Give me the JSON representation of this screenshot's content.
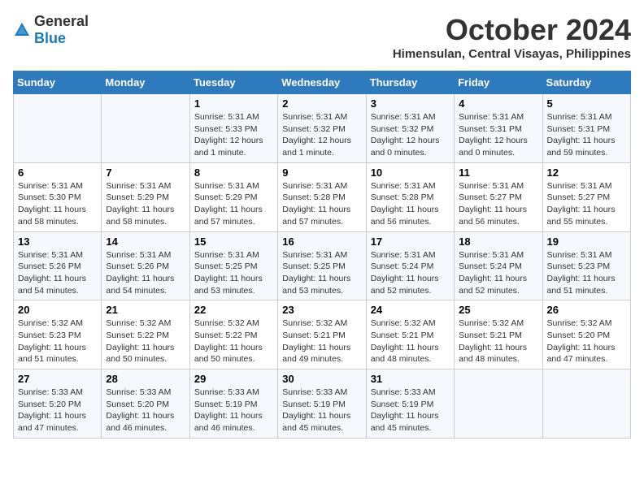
{
  "logo": {
    "text_general": "General",
    "text_blue": "Blue"
  },
  "header": {
    "month": "October 2024",
    "location": "Himensulan, Central Visayas, Philippines"
  },
  "days_of_week": [
    "Sunday",
    "Monday",
    "Tuesday",
    "Wednesday",
    "Thursday",
    "Friday",
    "Saturday"
  ],
  "weeks": [
    [
      {
        "day": "",
        "info": ""
      },
      {
        "day": "",
        "info": ""
      },
      {
        "day": "1",
        "info": "Sunrise: 5:31 AM\nSunset: 5:33 PM\nDaylight: 12 hours and 1 minute."
      },
      {
        "day": "2",
        "info": "Sunrise: 5:31 AM\nSunset: 5:32 PM\nDaylight: 12 hours and 1 minute."
      },
      {
        "day": "3",
        "info": "Sunrise: 5:31 AM\nSunset: 5:32 PM\nDaylight: 12 hours and 0 minutes."
      },
      {
        "day": "4",
        "info": "Sunrise: 5:31 AM\nSunset: 5:31 PM\nDaylight: 12 hours and 0 minutes."
      },
      {
        "day": "5",
        "info": "Sunrise: 5:31 AM\nSunset: 5:31 PM\nDaylight: 11 hours and 59 minutes."
      }
    ],
    [
      {
        "day": "6",
        "info": "Sunrise: 5:31 AM\nSunset: 5:30 PM\nDaylight: 11 hours and 58 minutes."
      },
      {
        "day": "7",
        "info": "Sunrise: 5:31 AM\nSunset: 5:29 PM\nDaylight: 11 hours and 58 minutes."
      },
      {
        "day": "8",
        "info": "Sunrise: 5:31 AM\nSunset: 5:29 PM\nDaylight: 11 hours and 57 minutes."
      },
      {
        "day": "9",
        "info": "Sunrise: 5:31 AM\nSunset: 5:28 PM\nDaylight: 11 hours and 57 minutes."
      },
      {
        "day": "10",
        "info": "Sunrise: 5:31 AM\nSunset: 5:28 PM\nDaylight: 11 hours and 56 minutes."
      },
      {
        "day": "11",
        "info": "Sunrise: 5:31 AM\nSunset: 5:27 PM\nDaylight: 11 hours and 56 minutes."
      },
      {
        "day": "12",
        "info": "Sunrise: 5:31 AM\nSunset: 5:27 PM\nDaylight: 11 hours and 55 minutes."
      }
    ],
    [
      {
        "day": "13",
        "info": "Sunrise: 5:31 AM\nSunset: 5:26 PM\nDaylight: 11 hours and 54 minutes."
      },
      {
        "day": "14",
        "info": "Sunrise: 5:31 AM\nSunset: 5:26 PM\nDaylight: 11 hours and 54 minutes."
      },
      {
        "day": "15",
        "info": "Sunrise: 5:31 AM\nSunset: 5:25 PM\nDaylight: 11 hours and 53 minutes."
      },
      {
        "day": "16",
        "info": "Sunrise: 5:31 AM\nSunset: 5:25 PM\nDaylight: 11 hours and 53 minutes."
      },
      {
        "day": "17",
        "info": "Sunrise: 5:31 AM\nSunset: 5:24 PM\nDaylight: 11 hours and 52 minutes."
      },
      {
        "day": "18",
        "info": "Sunrise: 5:31 AM\nSunset: 5:24 PM\nDaylight: 11 hours and 52 minutes."
      },
      {
        "day": "19",
        "info": "Sunrise: 5:31 AM\nSunset: 5:23 PM\nDaylight: 11 hours and 51 minutes."
      }
    ],
    [
      {
        "day": "20",
        "info": "Sunrise: 5:32 AM\nSunset: 5:23 PM\nDaylight: 11 hours and 51 minutes."
      },
      {
        "day": "21",
        "info": "Sunrise: 5:32 AM\nSunset: 5:22 PM\nDaylight: 11 hours and 50 minutes."
      },
      {
        "day": "22",
        "info": "Sunrise: 5:32 AM\nSunset: 5:22 PM\nDaylight: 11 hours and 50 minutes."
      },
      {
        "day": "23",
        "info": "Sunrise: 5:32 AM\nSunset: 5:21 PM\nDaylight: 11 hours and 49 minutes."
      },
      {
        "day": "24",
        "info": "Sunrise: 5:32 AM\nSunset: 5:21 PM\nDaylight: 11 hours and 48 minutes."
      },
      {
        "day": "25",
        "info": "Sunrise: 5:32 AM\nSunset: 5:21 PM\nDaylight: 11 hours and 48 minutes."
      },
      {
        "day": "26",
        "info": "Sunrise: 5:32 AM\nSunset: 5:20 PM\nDaylight: 11 hours and 47 minutes."
      }
    ],
    [
      {
        "day": "27",
        "info": "Sunrise: 5:33 AM\nSunset: 5:20 PM\nDaylight: 11 hours and 47 minutes."
      },
      {
        "day": "28",
        "info": "Sunrise: 5:33 AM\nSunset: 5:20 PM\nDaylight: 11 hours and 46 minutes."
      },
      {
        "day": "29",
        "info": "Sunrise: 5:33 AM\nSunset: 5:19 PM\nDaylight: 11 hours and 46 minutes."
      },
      {
        "day": "30",
        "info": "Sunrise: 5:33 AM\nSunset: 5:19 PM\nDaylight: 11 hours and 45 minutes."
      },
      {
        "day": "31",
        "info": "Sunrise: 5:33 AM\nSunset: 5:19 PM\nDaylight: 11 hours and 45 minutes."
      },
      {
        "day": "",
        "info": ""
      },
      {
        "day": "",
        "info": ""
      }
    ]
  ]
}
